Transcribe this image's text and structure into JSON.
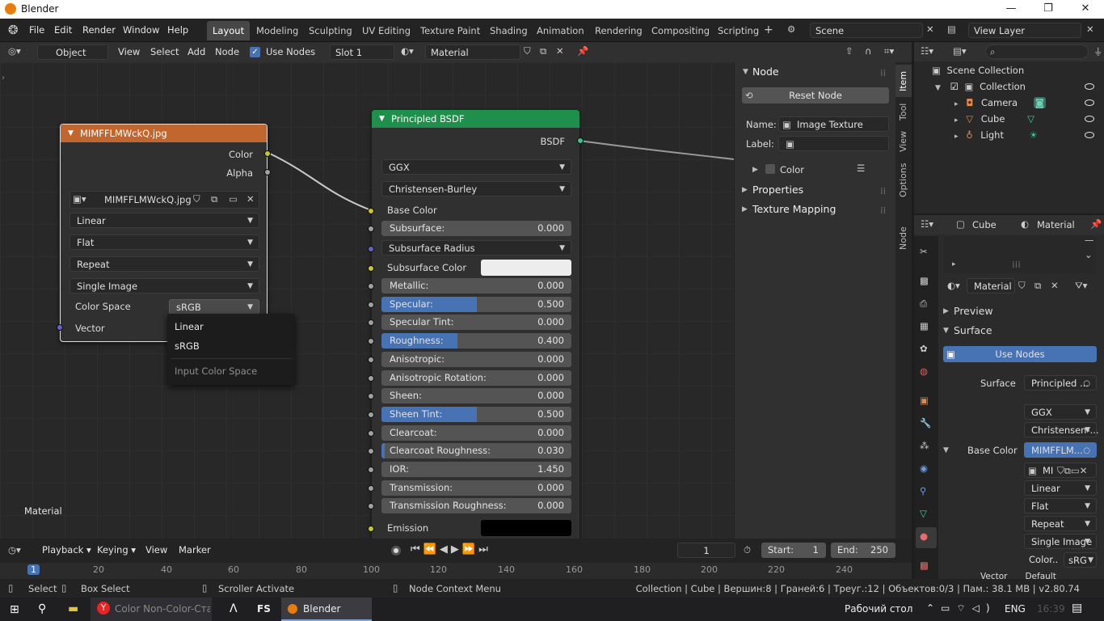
{
  "window": {
    "title": "Blender",
    "controls": [
      "—",
      "❐",
      "✕"
    ]
  },
  "menu": [
    "File",
    "Edit",
    "Render",
    "Window",
    "Help"
  ],
  "workspaces": {
    "active": "Layout",
    "tabs": [
      "Layout",
      "Modeling",
      "Sculpting",
      "UV Editing",
      "Texture Paint",
      "Shading",
      "Animation",
      "Rendering",
      "Compositing",
      "Scripting"
    ]
  },
  "scene": {
    "name": "Scene",
    "view_layer": "View Layer"
  },
  "node_header": {
    "mode": "Object",
    "items": [
      "View",
      "Select",
      "Add",
      "Node"
    ],
    "use_nodes_label": "Use Nodes",
    "slot": "Slot 1",
    "material": "Material"
  },
  "image_node": {
    "title": "MIMFFLMWckQ.jpg",
    "outputs": [
      "Color",
      "Alpha"
    ],
    "image_name": "MIMFFLMWckQ.jpg",
    "interpolation": "Linear",
    "projection": "Flat",
    "extension": "Repeat",
    "source": "Single Image",
    "color_space_label": "Color Space",
    "color_space_value": "sRGB",
    "input": "Vector"
  },
  "dropdown": {
    "options": [
      "Linear",
      "sRGB"
    ],
    "tooltip": "Input Color Space"
  },
  "bsdf_node": {
    "title": "Principled BSDF",
    "output": "BSDF",
    "distribution": "GGX",
    "subsurface_method": "Christensen-Burley",
    "base_color_label": "Base Color",
    "subsurface_radius_label": "Subsurface Radius",
    "subsurface_color_label": "Subsurface Color",
    "emission_label": "Emission",
    "sliders": [
      {
        "label": "Subsurface:",
        "value": "0.000",
        "fill": 0
      },
      {
        "label": "Metallic:",
        "value": "0.000",
        "fill": 0
      },
      {
        "label": "Specular:",
        "value": "0.500",
        "fill": 0.5
      },
      {
        "label": "Specular Tint:",
        "value": "0.000",
        "fill": 0
      },
      {
        "label": "Roughness:",
        "value": "0.400",
        "fill": 0.4
      },
      {
        "label": "Anisotropic:",
        "value": "0.000",
        "fill": 0
      },
      {
        "label": "Anisotropic Rotation:",
        "value": "0.000",
        "fill": 0
      },
      {
        "label": "Sheen:",
        "value": "0.000",
        "fill": 0
      },
      {
        "label": "Sheen Tint:",
        "value": "0.500",
        "fill": 0.5
      },
      {
        "label": "Clearcoat:",
        "value": "0.000",
        "fill": 0
      },
      {
        "label": "Clearcoat Roughness:",
        "value": "0.030",
        "fill": 0.03
      },
      {
        "label": "IOR:",
        "value": "1.450",
        "fill": 0
      },
      {
        "label": "Transmission:",
        "value": "0.000",
        "fill": 0
      },
      {
        "label": "Transmission Roughness:",
        "value": "0.000",
        "fill": 0
      }
    ]
  },
  "canvas_label": "Material",
  "npanel": {
    "section": "Node",
    "reset_label": "Reset Node",
    "name_label": "Name:",
    "name_value": "Image Texture",
    "label_label": "Label:",
    "color_label": "Color",
    "properties": "Properties",
    "texture_mapping": "Texture Mapping",
    "tabs": [
      "Item",
      "Tool",
      "View",
      "Options",
      "Node Wrangler"
    ]
  },
  "outliner": {
    "root": "Scene Collection",
    "collection": "Collection",
    "items": [
      "Camera",
      "Cube",
      "Light"
    ]
  },
  "properties": {
    "object": "Cube",
    "material_tab": "Material",
    "material_name": "Material",
    "preview": "Preview",
    "surface_section": "Surface",
    "use_nodes": "Use Nodes",
    "surface_label": "Surface",
    "surface_value": "Principled ...",
    "distribution": "GGX",
    "subsurface": "Christensen-...",
    "base_color_label": "Base Color",
    "base_color_value": "MIMFFLM...",
    "image_short": "MI",
    "interp": "Linear",
    "proj": "Flat",
    "ext": "Repeat",
    "source": "Single Image",
    "colorspace_label": "Color..",
    "colorspace_value": "sRG",
    "vector_label": "Vector",
    "vector_value": "Default"
  },
  "timeline": {
    "menus": [
      "Playback",
      "Keying",
      "View",
      "Marker"
    ],
    "frame": "1",
    "start_label": "Start:",
    "start": "1",
    "end_label": "End:",
    "end": "250",
    "ruler": [
      "1",
      "20",
      "40",
      "60",
      "80",
      "100",
      "120",
      "140",
      "160",
      "180",
      "200",
      "220",
      "240"
    ]
  },
  "status": {
    "select": "Select",
    "box_select": "Box Select",
    "scroller": "Scroller Activate",
    "context": "Node Context Menu",
    "stats": "Collection | Cube | Вершин:8 | Граней:6 | Треуг.:12 | Объектов:0/3 | Пам.: 38.1 MB | v2.80.74"
  },
  "taskbar": {
    "browser_tab": "Color Non-Color-Ста...",
    "fs": "FS",
    "blender": "Blender",
    "desktop": "Рабочий стол",
    "lang": "ENG",
    "time": "16:39"
  },
  "colors": {
    "image_header": "#c0662e",
    "shader_header": "#1f8f4c",
    "slider_fill": "#4772b3",
    "accent": "#4772b3"
  }
}
